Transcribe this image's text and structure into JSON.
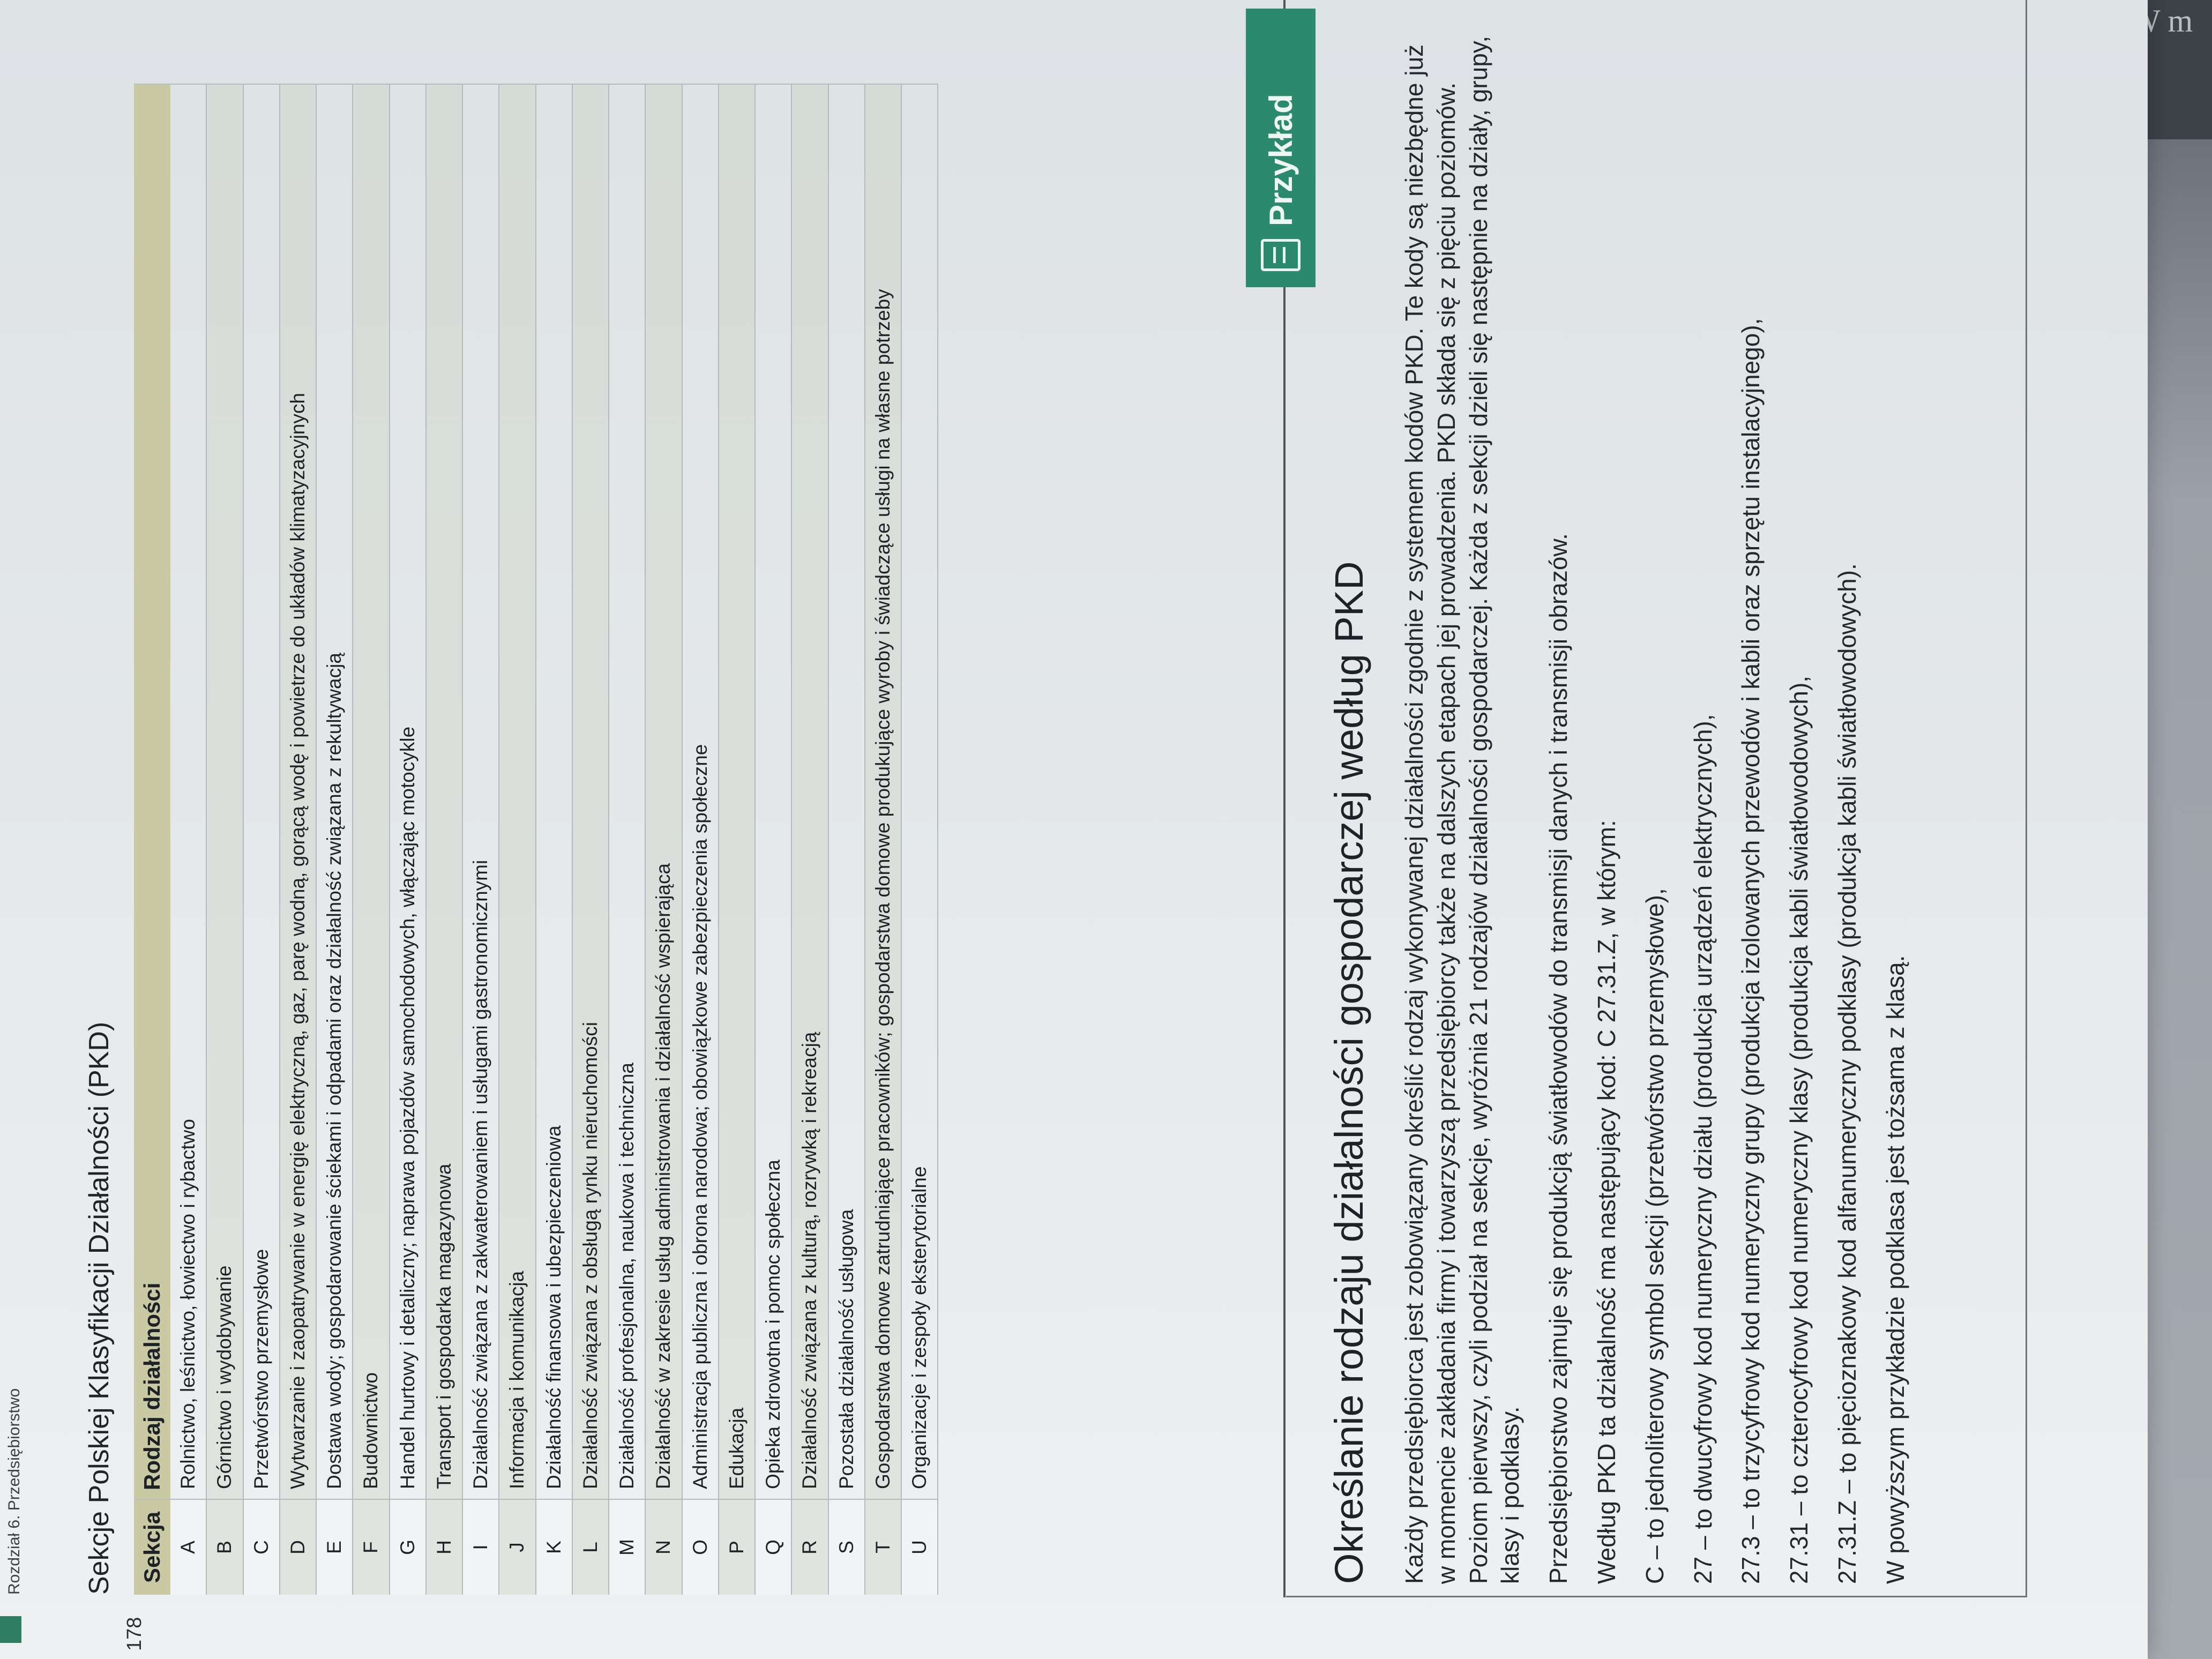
{
  "page": {
    "running_head": "Rozdział 6. Przedsiębiorstwo",
    "page_number": "178",
    "edge_text": "W\nm"
  },
  "table": {
    "title": "Sekcje Polskiej Klasyfikacji Działalności (PKD)",
    "header_section": "Sekcja",
    "header_activity": "Rodzaj działalności",
    "rows": [
      {
        "code": "A",
        "text": "Rolnictwo, leśnictwo, łowiectwo i rybactwo"
      },
      {
        "code": "B",
        "text": "Górnictwo i wydobywanie"
      },
      {
        "code": "C",
        "text": "Przetwórstwo przemysłowe"
      },
      {
        "code": "D",
        "text": "Wytwarzanie i zaopatrywanie w energię elektryczną, gaz, parę wodną, gorącą wodę i powietrze do układów klimatyzacyjnych"
      },
      {
        "code": "E",
        "text": "Dostawa wody; gospodarowanie ściekami i odpadami oraz działalność związana z rekultywacją"
      },
      {
        "code": "F",
        "text": "Budownictwo"
      },
      {
        "code": "G",
        "text": "Handel hurtowy i detaliczny; naprawa pojazdów samochodowych, włączając motocykle"
      },
      {
        "code": "H",
        "text": "Transport i gospodarka magazynowa"
      },
      {
        "code": "I",
        "text": "Działalność związana z zakwaterowaniem i usługami gastronomicznymi"
      },
      {
        "code": "J",
        "text": "Informacja i komunikacja"
      },
      {
        "code": "K",
        "text": "Działalność finansowa i ubezpieczeniowa"
      },
      {
        "code": "L",
        "text": "Działalność związana z obsługą rynku nieruchomości"
      },
      {
        "code": "M",
        "text": "Działalność profesjonalna, naukowa i techniczna"
      },
      {
        "code": "N",
        "text": "Działalność w zakresie usług administrowania i działalność wspierająca"
      },
      {
        "code": "O",
        "text": "Administracja publiczna i obrona narodowa; obowiązkowe zabezpieczenia społeczne"
      },
      {
        "code": "P",
        "text": "Edukacja"
      },
      {
        "code": "Q",
        "text": "Opieka zdrowotna i pomoc społeczna"
      },
      {
        "code": "R",
        "text": "Działalność związana z kulturą, rozrywką i rekreacją"
      },
      {
        "code": "S",
        "text": "Pozostała działalność usługowa"
      },
      {
        "code": "T",
        "text": "Gospodarstwa domowe zatrudniające pracowników; gospodarstwa domowe produkujące wyroby i świadczące usługi na własne potrzeby"
      },
      {
        "code": "U",
        "text": "Organizacje i zespoły eksterytorialne"
      }
    ]
  },
  "example": {
    "badge": "Przykład",
    "badge_icon": "document-icon",
    "title": "Określanie rodzaju działalności gospodarczej według PKD",
    "para1": "Każdy przedsiębiorca jest zobowiązany określić rodzaj wykonywanej działalności zgodnie z systemem kodów PKD. Te kody są niezbędne już w momencie zakładania firmy i towarzyszą przedsiębiorcy także na dalszych etapach jej prowadzenia. PKD składa się z pięciu poziomów. Poziom pierwszy, czyli podział na sekcje, wyróżnia 21 rodzajów działalności gospodarczej. Każda z sekcji dzieli się następnie na działy, grupy, klasy i podklasy.",
    "para2": "Przedsiębiorstwo zajmuje się produkcją światłowodów do transmisji danych i transmisji obrazów.",
    "para3": "Według PKD ta działalność ma następujący kod: C 27.31.Z, w którym:",
    "list": [
      "C – to jednoliterowy symbol sekcji (przetwórstwo przemysłowe),",
      "27 – to dwucyfrowy kod numeryczny działu (produkcja urządzeń elektrycznych),",
      "27.3 – to trzycyfrowy kod numeryczny grupy (produkcja izolowanych przewodów i kabli oraz sprzętu instalacyjnego),",
      "27.31 – to czterocyfrowy kod numeryczny klasy (produkcja kabli światłowodowych),",
      "27.31.Z – to pięcioznakowy kod alfanumeryczny podklasy (produkcja kabli światłowodowych)."
    ],
    "para4": "W powyższym przykładzie podklasa jest tożsama z klasą."
  }
}
